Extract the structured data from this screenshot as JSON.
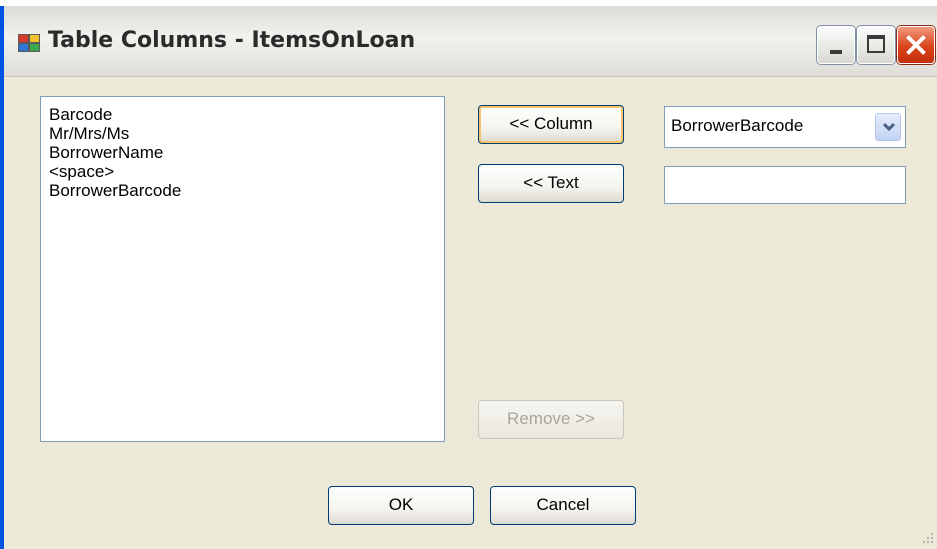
{
  "window": {
    "title": "Table Columns - ItemsOnLoan"
  },
  "column_list": {
    "items": [
      "Barcode",
      "Mr/Mrs/Ms",
      "BorrowerName",
      "<space>",
      "BorrowerBarcode"
    ]
  },
  "buttons": {
    "add_column": "<< Column",
    "add_text": "<< Text",
    "remove": "Remove >>",
    "ok": "OK",
    "cancel": "Cancel"
  },
  "column_select": {
    "value": "BorrowerBarcode"
  },
  "text_input": {
    "value": ""
  },
  "colors": {
    "window_bg": "#ECE9D8",
    "frame_border": "#0054E3",
    "field_border": "#7f9db9",
    "disabled_text": "#a7a69d",
    "close_red": "#d9441b"
  }
}
